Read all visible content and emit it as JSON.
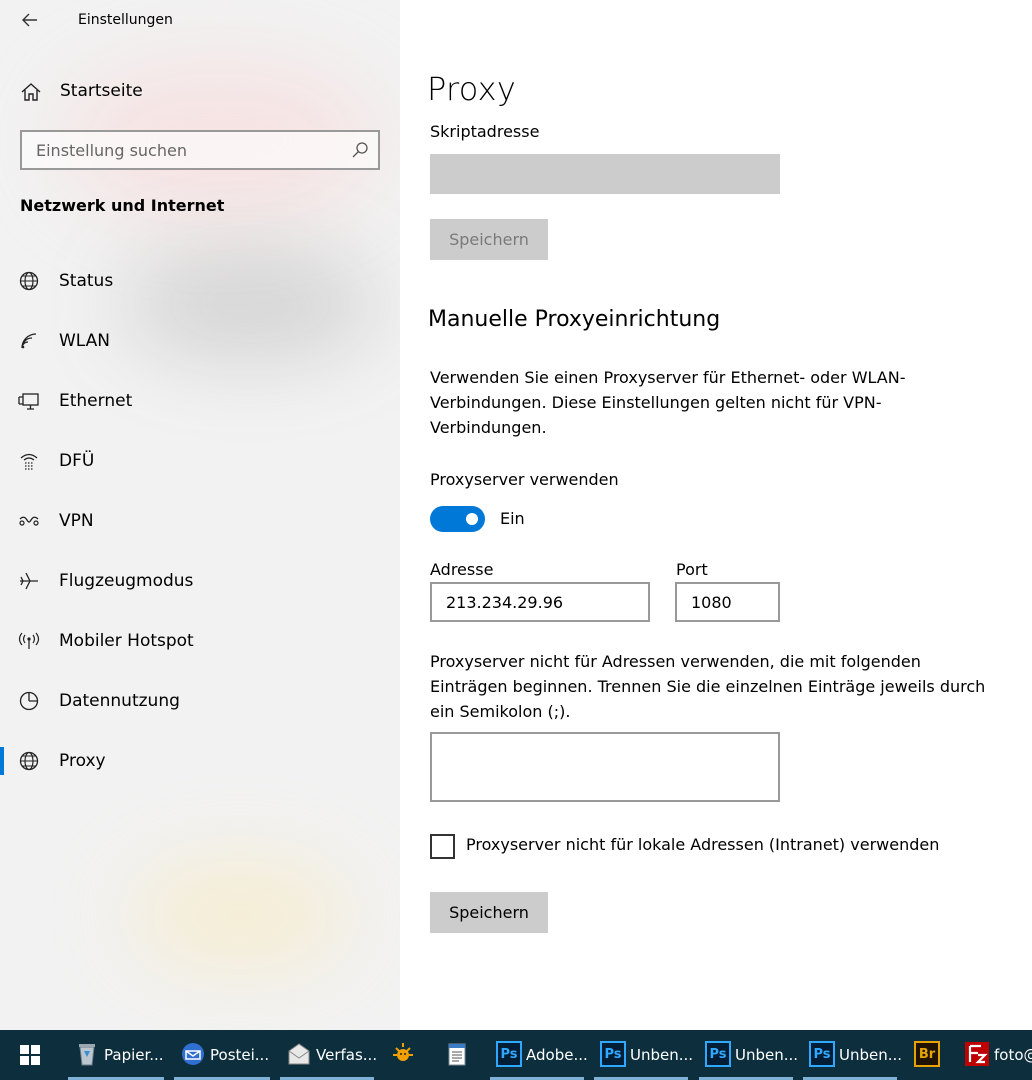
{
  "window": {
    "app_title": "Einstellungen"
  },
  "sidebar": {
    "home_label": "Startseite",
    "search_placeholder": "Einstellung suchen",
    "section_title": "Netzwerk und Internet",
    "items": [
      {
        "label": "Status",
        "icon": "globe-status-icon"
      },
      {
        "label": "WLAN",
        "icon": "wifi-icon"
      },
      {
        "label": "Ethernet",
        "icon": "ethernet-icon"
      },
      {
        "label": "DFÜ",
        "icon": "dialup-icon"
      },
      {
        "label": "VPN",
        "icon": "vpn-icon"
      },
      {
        "label": "Flugzeugmodus",
        "icon": "airplane-icon"
      },
      {
        "label": "Mobiler Hotspot",
        "icon": "hotspot-icon"
      },
      {
        "label": "Datennutzung",
        "icon": "data-usage-icon"
      },
      {
        "label": "Proxy",
        "icon": "globe-icon",
        "active": true
      }
    ]
  },
  "main": {
    "title": "Proxy",
    "script_address_label": "Skriptadresse",
    "script_address_value": "",
    "save_label": "Speichern",
    "manual_title": "Manuelle Proxyeinrichtung",
    "manual_description": "Verwenden Sie einen Proxyserver für Ethernet- oder WLAN-Verbindungen. Diese Einstellungen gelten nicht für VPN-Verbindungen.",
    "use_proxy_label": "Proxyserver verwenden",
    "use_proxy_state": "Ein",
    "use_proxy_on": true,
    "address_label": "Adresse",
    "address_value": "213.234.29.96",
    "port_label": "Port",
    "port_value": "1080",
    "exceptions_description": "Proxyserver nicht für Adressen verwenden, die mit folgenden Einträgen beginnen. Trennen Sie die einzelnen Einträge jeweils durch ein Semikolon (;).",
    "exceptions_value": "",
    "local_bypass_label": "Proxyserver nicht für lokale Adressen (Intranet) verwenden",
    "local_bypass_checked": false,
    "save_label_2": "Speichern"
  },
  "taskbar": {
    "items": [
      {
        "label": "Papier...",
        "icon": "recycle-bin-icon"
      },
      {
        "label": "Postei...",
        "icon": "mail-inbox-icon"
      },
      {
        "label": "Verfas...",
        "icon": "compose-mail-icon"
      },
      {
        "label": "",
        "icon": "app-sun-icon"
      },
      {
        "label": "",
        "icon": "notepad-icon"
      },
      {
        "label": "Adobe...",
        "icon": "photoshop-icon",
        "glyph": "Ps"
      },
      {
        "label": "Unben...",
        "icon": "photoshop-icon",
        "glyph": "Ps"
      },
      {
        "label": "Unben...",
        "icon": "photoshop-icon",
        "glyph": "Ps"
      },
      {
        "label": "Unben...",
        "icon": "photoshop-icon",
        "glyph": "Ps"
      },
      {
        "label": "",
        "icon": "bridge-icon",
        "glyph": "Br"
      },
      {
        "label": "foto@",
        "icon": "filezilla-icon"
      }
    ]
  },
  "colors": {
    "accent": "#0078d7",
    "taskbar": "#0d2e3d",
    "sidebar": "#f2f2f2"
  }
}
